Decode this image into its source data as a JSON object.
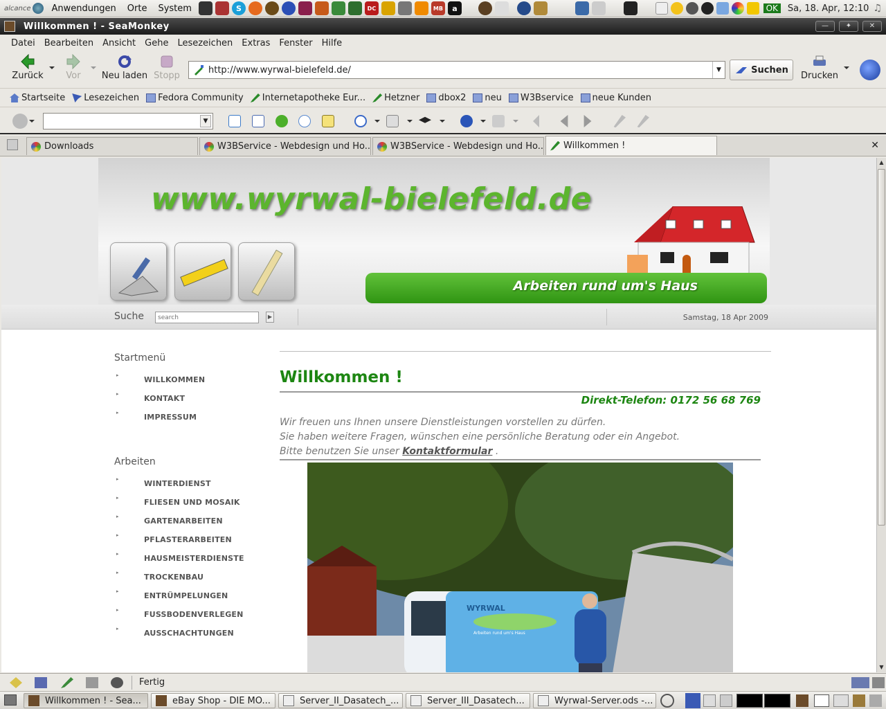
{
  "top_panel": {
    "brand": "alcance",
    "menus": [
      "Anwendungen",
      "Orte",
      "System"
    ],
    "clock": "Sa, 18. Apr, 12:10",
    "ok_badge": "OK"
  },
  "window": {
    "title": "Willkommen ! - SeaMonkey"
  },
  "menubar": [
    "Datei",
    "Bearbeiten",
    "Ansicht",
    "Gehe",
    "Lesezeichen",
    "Extras",
    "Fenster",
    "Hilfe"
  ],
  "nav": {
    "back": "Zurück",
    "forward": "Vor",
    "reload": "Neu laden",
    "stop": "Stopp",
    "url": "http://www.wyrwal-bielefeld.de/",
    "search": "Suchen",
    "print": "Drucken"
  },
  "bookmarks": [
    "Startseite",
    "Lesezeichen",
    "Fedora Community",
    "Internetapotheke Eur...",
    "Hetzner",
    "dbox2",
    "neu",
    "W3Bservice",
    "neue Kunden"
  ],
  "tabs": [
    {
      "label": "Downloads",
      "active": false
    },
    {
      "label": "W3BService - Webdesign und Ho...",
      "active": false
    },
    {
      "label": "W3BService - Webdesign und Ho...",
      "active": false
    },
    {
      "label": "Willkommen !",
      "active": true
    }
  ],
  "site": {
    "logo_text": "www.wyrwal-bielefeld.de",
    "slogan": "Arbeiten rund um's Haus",
    "search_label": "Suche",
    "search_placeholder": "search",
    "date": "Samstag, 18 Apr 2009",
    "sidebar": [
      {
        "heading": "Startmenü",
        "items": [
          "WILLKOMMEN",
          "KONTAKT",
          "IMPRESSUM"
        ]
      },
      {
        "heading": "Arbeiten",
        "items": [
          "WINTERDIENST",
          "FLIESEN UND MOSAIK",
          "GARTENARBEITEN",
          "PFLASTERARBEITEN",
          "HAUSMEISTERDIENSTE",
          "TROCKENBAU",
          "ENTRÜMPELUNGEN",
          "FUSSBODENVERLEGEN",
          "AUSSCHACHTUNGEN"
        ]
      }
    ],
    "main": {
      "title": "Willkommen !",
      "phone": "Direkt-Telefon: 0172 56 68 769",
      "intro_line1": "Wir freuen uns Ihnen unsere Dienstleistungen vorstellen zu dürfen.",
      "intro_line2": "Sie haben weitere Fragen, wünschen eine persönliche Beratung oder ein Angebot.",
      "intro_line3_prefix": "Bitte benutzen Sie unser",
      "intro_link": "Kontaktformular",
      "intro_line3_suffix": ".",
      "van_text_1": "WYRWAL",
      "van_text_2": "Arbeiten rund um's Haus"
    }
  },
  "status": {
    "text": "Fertig"
  },
  "taskbar": [
    {
      "label": "Willkommen ! - Sea...",
      "active": true
    },
    {
      "label": "eBay Shop - DIE MO...",
      "active": false
    },
    {
      "label": "Server_II_Dasatech_...",
      "active": false
    },
    {
      "label": "Server_III_Dasatech...",
      "active": false
    },
    {
      "label": "Wyrwal-Server.ods -...",
      "active": false
    }
  ],
  "colors": {
    "site_green": "#1d8612",
    "logo_green": "#5cb52e",
    "titlebar": "#1c1c1c"
  }
}
